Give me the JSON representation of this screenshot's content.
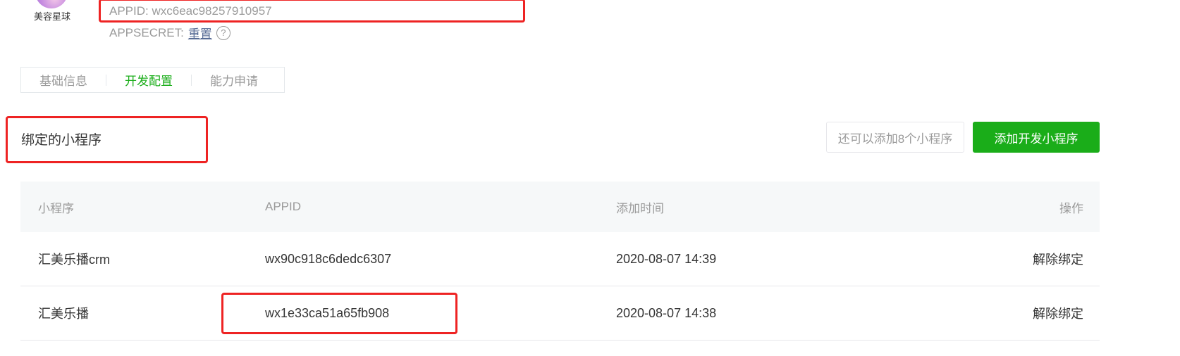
{
  "app": {
    "name": "美容星球",
    "appid_label": "APPID: wxc6eac98257910957",
    "secret_prefix": "APPSECRET:",
    "secret_action": "重置",
    "help_glyph": "?"
  },
  "tabs": [
    {
      "label": "基础信息",
      "active": false
    },
    {
      "label": "开发配置",
      "active": true
    },
    {
      "label": "能力申请",
      "active": false
    }
  ],
  "section": {
    "title": "绑定的小程序",
    "quota_text": "还可以添加8个小程序",
    "add_button": "添加开发小程序"
  },
  "table": {
    "headers": [
      "小程序",
      "APPID",
      "添加时间",
      "操作"
    ],
    "rows": [
      {
        "name": "汇美乐播crm",
        "appid": "wx90c918c6dedc6307",
        "time": "2020-08-07 14:39",
        "action": "解除绑定"
      },
      {
        "name": "汇美乐播",
        "appid": "wx1e33ca51a65fb908",
        "time": "2020-08-07 14:38",
        "action": "解除绑定"
      }
    ]
  },
  "colors": {
    "accent_green": "#1aad19",
    "link_blue": "#576b95",
    "annotation_red": "#ee2323",
    "muted_text": "#9a9a9a"
  }
}
